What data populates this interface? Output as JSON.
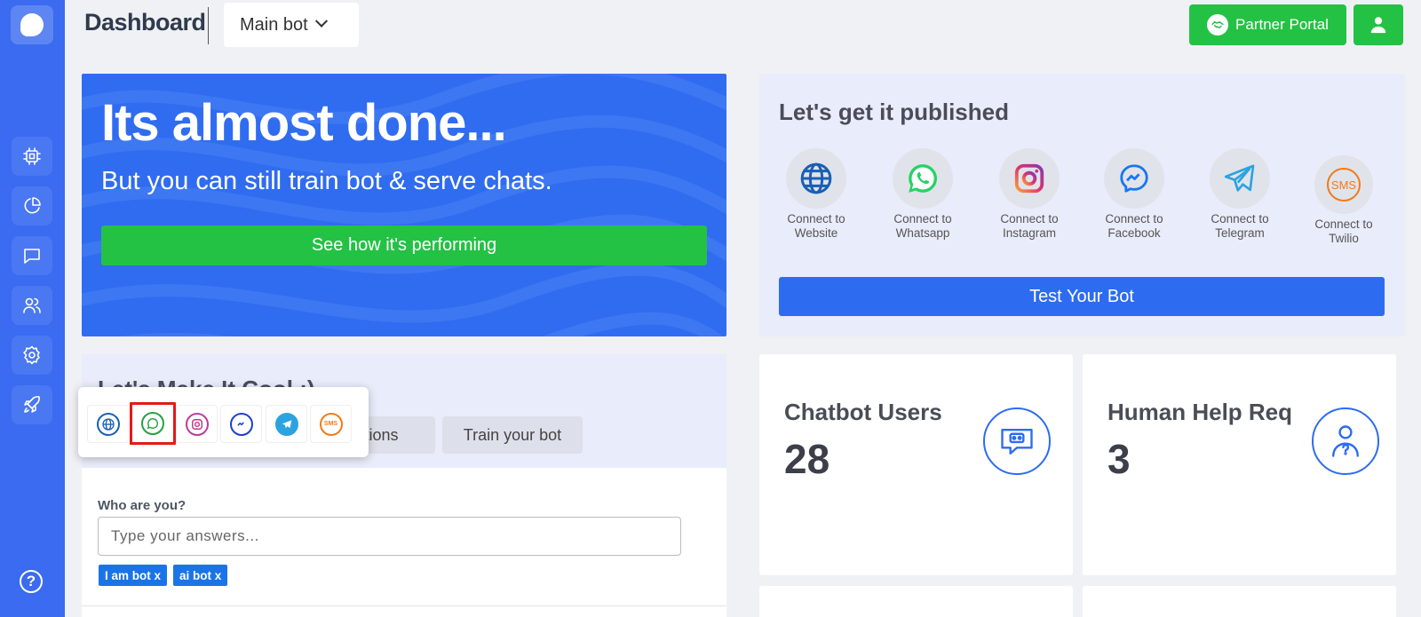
{
  "header": {
    "title": "Dashboard",
    "bot_selector": "Main bot",
    "partner_button": "Partner Portal"
  },
  "sidebar": {
    "items": [
      {
        "name": "bot-builder",
        "icon": "chip-icon"
      },
      {
        "name": "analytics",
        "icon": "pie-chart-icon"
      },
      {
        "name": "chats",
        "icon": "chat-icon"
      },
      {
        "name": "users",
        "icon": "users-icon"
      },
      {
        "name": "settings",
        "icon": "gear-icon"
      },
      {
        "name": "launch",
        "icon": "rocket-icon"
      }
    ],
    "help": "?"
  },
  "hero": {
    "title": "Its almost done...",
    "subtitle": "But you can still train bot & serve chats.",
    "button": "See how it's performing"
  },
  "publish": {
    "title": "Let's get it published",
    "channels": [
      {
        "label": "Connect to Website",
        "icon": "globe-icon"
      },
      {
        "label": "Connect to Whatsapp",
        "icon": "whatsapp-icon"
      },
      {
        "label": "Connect to Instagram",
        "icon": "instagram-icon"
      },
      {
        "label": "Connect to Facebook",
        "icon": "messenger-icon"
      },
      {
        "label": "Connect to Telegram",
        "icon": "telegram-icon"
      },
      {
        "label": "Connect to Twilio",
        "icon": "sms-icon"
      }
    ],
    "test_button": "Test Your Bot",
    "sms_text": "SMS"
  },
  "cool": {
    "title": "Let's Make It Cool :)",
    "tabs": [
      "estions",
      "Train your bot"
    ],
    "question_label": "Who are you?",
    "answer_placeholder": "Type your answers...",
    "chips": [
      "I am bot x",
      "ai bot x"
    ]
  },
  "popup": {
    "channels": [
      "globe-icon",
      "whatsapp-icon",
      "instagram-icon",
      "messenger-icon",
      "telegram-icon",
      "sms-icon"
    ],
    "selected": "whatsapp-icon",
    "sms_text": "SMS"
  },
  "stats": [
    {
      "label": "Chatbot Users",
      "value": "28",
      "icon": "bot-chat-icon"
    },
    {
      "label": "Human Help Req",
      "value": "3",
      "icon": "help-user-icon"
    }
  ],
  "colors": {
    "sidebar": "#3a6bf0",
    "primary": "#2d6cf0",
    "success": "#23c244",
    "selected_outline": "#e01b1b"
  }
}
